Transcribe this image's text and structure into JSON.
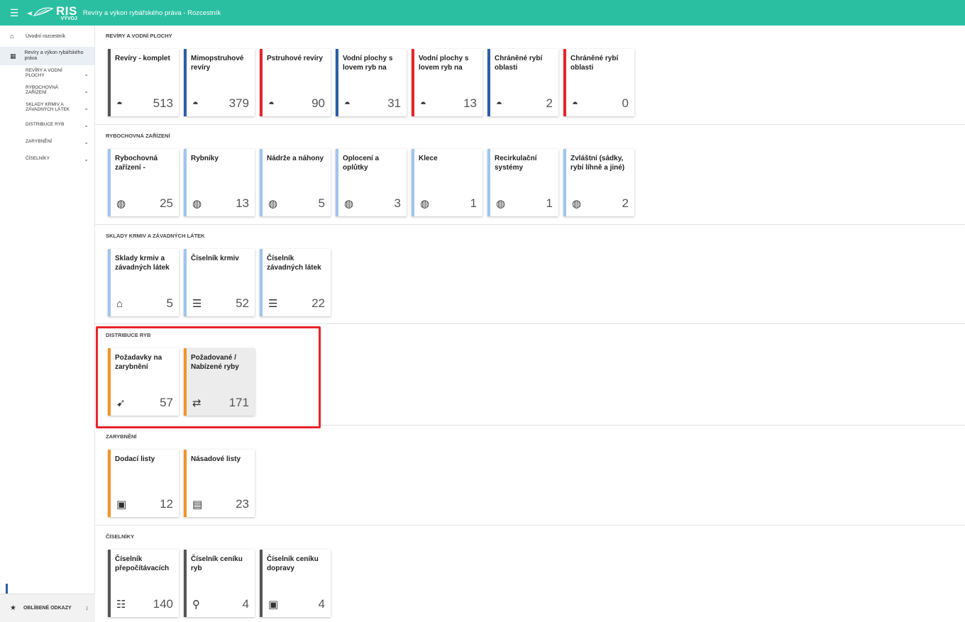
{
  "header": {
    "menu_icon": "hamburger-icon",
    "logo_text": "RIS",
    "logo_env": "VÝVOJ",
    "title": "Revíry a výkon rybářského práva - Rozcestník",
    "color": "#2bbfa2"
  },
  "sidebar": {
    "home": {
      "label": "Úvodní rozcestník",
      "icon": "home-icon"
    },
    "active": {
      "label": "Revíry a výkon rybářského práva",
      "icon": "dashboard-icon"
    },
    "items": [
      {
        "label": "REVÍRY A VODNÍ PLOCHY"
      },
      {
        "label": "RYBOCHOVNÁ ZAŘÍZENÍ"
      },
      {
        "label": "SKLADY KRMIV A ZÁVADNÝCH LÁTEK"
      },
      {
        "label": "DISTRIBUCE RYB"
      },
      {
        "label": "ZARYBNĚNÍ"
      },
      {
        "label": "ČÍSELNÍKY"
      }
    ],
    "favorites": "OBLÍBENÉ ODKAZY"
  },
  "sections": [
    {
      "title": "REVÍRY A VODNÍ PLOCHY",
      "tiles": [
        {
          "label": "Revíry - komplet",
          "count": "513",
          "color": "#555555",
          "icon": "water-icon"
        },
        {
          "label": "Mimopstruhové revíry",
          "count": "379",
          "color": "#2e5da8",
          "icon": "water-icon"
        },
        {
          "label": "Pstruhové revíry",
          "count": "90",
          "color": "#e8232b",
          "icon": "water-icon"
        },
        {
          "label": "Vodní plochy s lovem ryb na",
          "count": "31",
          "color": "#2e5da8",
          "icon": "water-icon"
        },
        {
          "label": "Vodní plochy s lovem ryb na",
          "count": "13",
          "color": "#e8232b",
          "icon": "water-icon"
        },
        {
          "label": "Chráněné rybí oblasti",
          "count": "2",
          "color": "#2e5da8",
          "icon": "water-icon"
        },
        {
          "label": "Chráněné rybí oblasti",
          "count": "0",
          "color": "#e8232b",
          "icon": "water-icon"
        }
      ]
    },
    {
      "title": "RYBOCHOVNÁ ZAŘÍZENÍ",
      "tiles": [
        {
          "label": "Rybochovná zařízení -",
          "count": "25",
          "color": "#9fc5ec",
          "icon": "fish-circle-icon"
        },
        {
          "label": "Rybníky",
          "count": "13",
          "color": "#9fc5ec",
          "icon": "fish-circle-icon"
        },
        {
          "label": "Nádrže a náhony",
          "count": "5",
          "color": "#9fc5ec",
          "icon": "fish-circle-icon"
        },
        {
          "label": "Oplocení a oplůtky",
          "count": "3",
          "color": "#9fc5ec",
          "icon": "fish-circle-icon"
        },
        {
          "label": "Klece",
          "count": "1",
          "color": "#9fc5ec",
          "icon": "fish-circle-icon"
        },
        {
          "label": "Recirkulační systémy",
          "count": "1",
          "color": "#9fc5ec",
          "icon": "fish-circle-icon"
        },
        {
          "label": "Zvláštní (sádky, rybí líhně a jiné)",
          "count": "2",
          "color": "#9fc5ec",
          "icon": "fish-circle-icon"
        }
      ]
    },
    {
      "title": "SKLADY KRMIV A ZÁVADNÝCH LÁTEK",
      "tiles": [
        {
          "label": "Sklady krmiv a závadných látek",
          "count": "5",
          "color": "#9fc5ec",
          "icon": "warehouse-icon"
        },
        {
          "label": "Číselník krmiv",
          "count": "52",
          "color": "#9fc5ec",
          "icon": "feed-list-icon"
        },
        {
          "label": "Číselník závadných látek",
          "count": "22",
          "color": "#9fc5ec",
          "icon": "hazard-list-icon"
        }
      ]
    },
    {
      "title": "DISTRIBUCE RYB",
      "tiles": [
        {
          "label": "Požadavky na zarybnění",
          "count": "57",
          "color": "#f0952a",
          "icon": "fish-request-icon"
        },
        {
          "label": "Požadované / Nabízené ryby",
          "count": "171",
          "color": "#f0952a",
          "icon": "fish-exchange-icon"
        }
      ]
    },
    {
      "title": "ZARYBNĚNÍ",
      "tiles": [
        {
          "label": "Dodací listy",
          "count": "12",
          "color": "#f0952a",
          "icon": "delivery-doc-icon"
        },
        {
          "label": "Násadové listy",
          "count": "23",
          "color": "#f0952a",
          "icon": "stocking-doc-icon"
        }
      ]
    },
    {
      "title": "ČÍSELNÍKY",
      "tiles": [
        {
          "label": "Číselník přepočítávacích",
          "count": "140",
          "color": "#555555",
          "icon": "conversion-list-icon"
        },
        {
          "label": "Číselník ceníku ryb",
          "count": "4",
          "color": "#555555",
          "icon": "price-fish-icon"
        },
        {
          "label": "Číselník ceníku dopravy",
          "count": "4",
          "color": "#555555",
          "icon": "price-transport-icon"
        }
      ]
    }
  ]
}
